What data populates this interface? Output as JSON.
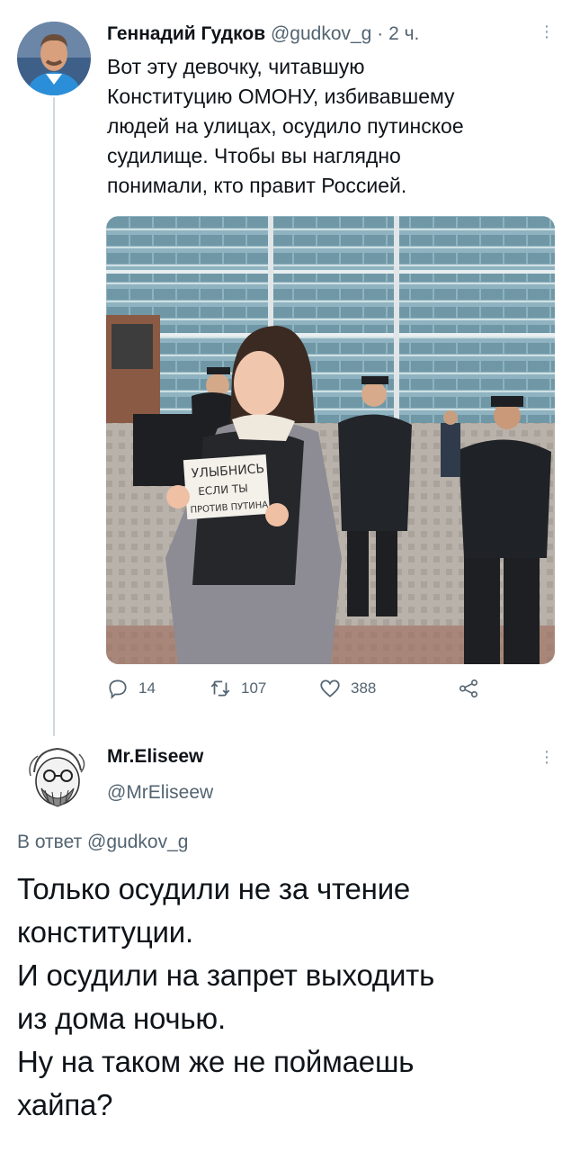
{
  "tweet1": {
    "author_name": "Геннадий Гудков",
    "author_handle": "@gudkov_g",
    "separator": "·",
    "time": "2 ч.",
    "text": "Вот эту девочку, читавшую\nКонституцию ОМОНУ, избивавшему\nлюдей на улицах, осудило путинское\nсудилище. Чтобы вы наглядно\nпонимали, кто правит Россией.",
    "photo": {
      "sign_line1": "УЛЫБНИСЬ",
      "sign_line2": "ЕСЛИ ТЫ",
      "sign_line3": "ПРОТИВ ПУТИНА"
    },
    "actions": {
      "reply_count": "14",
      "retweet_count": "107",
      "like_count": "388",
      "reply_icon": "comment-icon",
      "retweet_icon": "retweet-icon",
      "like_icon": "heart-icon",
      "share_icon": "share-icon"
    }
  },
  "tweet2": {
    "author_name": "Mr.Eliseew",
    "author_handle": "@MrEliseew",
    "reply_prefix": "В ответ",
    "reply_handle": "@gudkov_g",
    "text": "Только осудили не за чтение\nконституции.\nИ осудили на запрет выходить\nиз дома ночью.\nНу на таком же не поймаешь\nхайпа?"
  },
  "colors": {
    "text": "#0f1419",
    "secondary": "#536471",
    "thread_line": "#cfd9de"
  }
}
